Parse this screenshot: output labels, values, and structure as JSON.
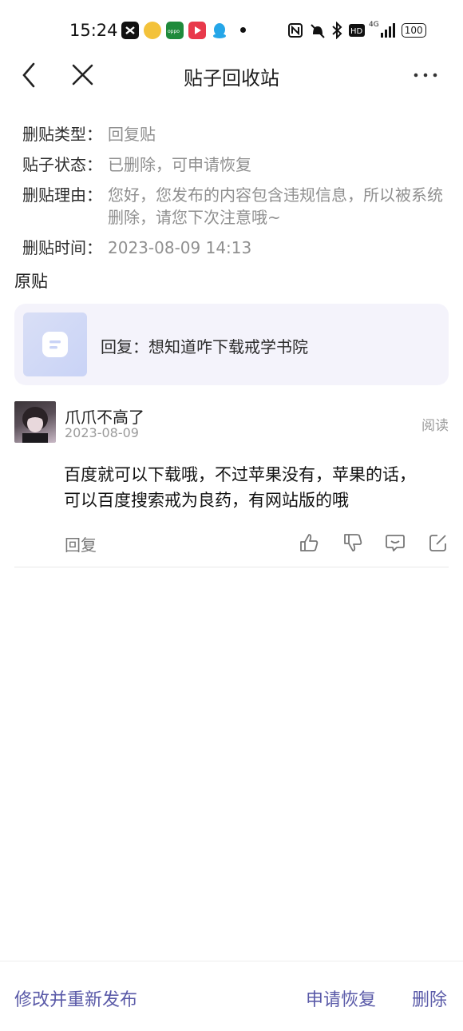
{
  "status_bar": {
    "time": "15:24",
    "battery": "100",
    "network": "4G"
  },
  "nav": {
    "title": "贴子回收站"
  },
  "deletion_info": {
    "type_label": "删贴类型：",
    "type_value": "回复贴",
    "status_label": "贴子状态：",
    "status_value": "已删除，可申请恢复",
    "reason_label": "删贴理由：",
    "reason_value": "您好，您发布的内容包含违规信息，所以被系统删除，请您下次注意哦~",
    "time_label": "删贴时间：",
    "time_value": "2023-08-09 14:13"
  },
  "original": {
    "section_title": "原贴",
    "title": "回复：想知道咋下载戒学书院"
  },
  "reply": {
    "username": "爪爪不高了",
    "date": "2023-08-09",
    "read_label": "阅读",
    "content": "百度就可以下载哦，不过苹果没有，苹果的话，可以百度搜索戒为良药，有网站版的哦",
    "reply_label": "回复"
  },
  "bottom_bar": {
    "edit_republish": "修改并重新发布",
    "restore": "申请恢复",
    "delete": "删除"
  },
  "colors": {
    "accent": "#5a5aa8",
    "card_bg": "#f4f3fb",
    "muted": "#8f8f8f"
  }
}
